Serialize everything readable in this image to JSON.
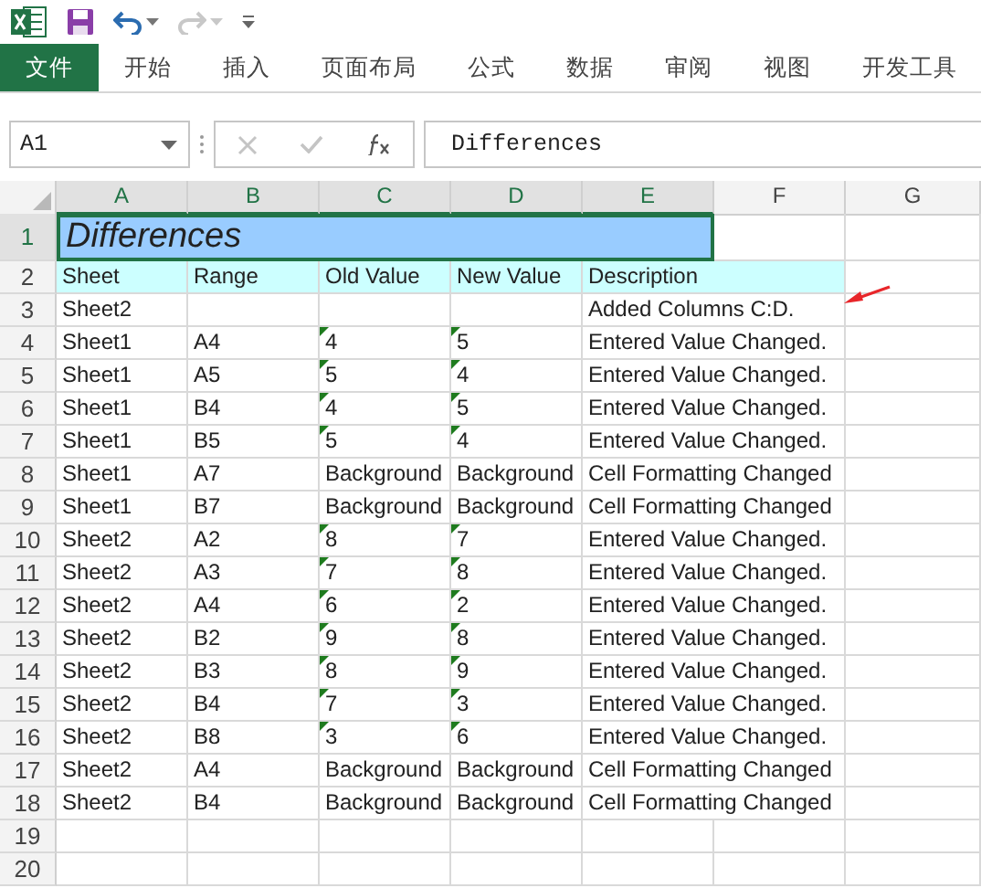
{
  "quick_access": {
    "undo_enabled": true,
    "redo_enabled": false
  },
  "ribbon_tabs": [
    {
      "label": "文件",
      "kind": "file"
    },
    {
      "label": "开始",
      "kind": "tab"
    },
    {
      "label": "插入",
      "kind": "tab"
    },
    {
      "label": "页面布局",
      "kind": "tab"
    },
    {
      "label": "公式",
      "kind": "tab"
    },
    {
      "label": "数据",
      "kind": "tab"
    },
    {
      "label": "审阅",
      "kind": "tab"
    },
    {
      "label": "视图",
      "kind": "tab"
    },
    {
      "label": "开发工具",
      "kind": "tab"
    }
  ],
  "formula_bar": {
    "name_box": "A1",
    "formula": "Differences"
  },
  "sheet": {
    "columns": [
      {
        "label": "A",
        "selected": true
      },
      {
        "label": "B",
        "selected": true
      },
      {
        "label": "C",
        "selected": true
      },
      {
        "label": "D",
        "selected": true
      },
      {
        "label": "E",
        "selected": true
      },
      {
        "label": "F",
        "selected": false
      },
      {
        "label": "G",
        "selected": false
      }
    ],
    "rows": [
      {
        "number": "1",
        "selected": true,
        "kind": "title",
        "title": "Differences"
      },
      {
        "number": "2",
        "selected": false,
        "kind": "header",
        "sheet": "Sheet",
        "range": "Range",
        "old_value": "Old Value",
        "new_value": "New Value",
        "description": "Description"
      },
      {
        "number": "3",
        "selected": false,
        "kind": "data",
        "flagged": false,
        "sheet": "Sheet2",
        "description": "Added Columns C:D."
      },
      {
        "number": "4",
        "selected": false,
        "kind": "data",
        "flagged": true,
        "sheet": "Sheet1",
        "range": "A4",
        "old_value": "4",
        "new_value": "5",
        "description": "Entered Value Changed."
      },
      {
        "number": "5",
        "selected": false,
        "kind": "data",
        "flagged": true,
        "sheet": "Sheet1",
        "range": "A5",
        "old_value": "5",
        "new_value": "4",
        "description": "Entered Value Changed."
      },
      {
        "number": "6",
        "selected": false,
        "kind": "data",
        "flagged": true,
        "sheet": "Sheet1",
        "range": "B4",
        "old_value": "4",
        "new_value": "5",
        "description": "Entered Value Changed."
      },
      {
        "number": "7",
        "selected": false,
        "kind": "data",
        "flagged": true,
        "sheet": "Sheet1",
        "range": "B5",
        "old_value": "5",
        "new_value": "4",
        "description": "Entered Value Changed."
      },
      {
        "number": "8",
        "selected": false,
        "kind": "data",
        "flagged": false,
        "sheet": "Sheet1",
        "range": "A7",
        "old_value": "Background",
        "new_value": "Background",
        "description": "Cell Formatting Changed"
      },
      {
        "number": "9",
        "selected": false,
        "kind": "data",
        "flagged": false,
        "sheet": "Sheet1",
        "range": "B7",
        "old_value": "Background",
        "new_value": "Background",
        "description": "Cell Formatting Changed"
      },
      {
        "number": "10",
        "selected": false,
        "kind": "data",
        "flagged": true,
        "sheet": "Sheet2",
        "range": "A2",
        "old_value": "8",
        "new_value": "7",
        "description": "Entered Value Changed."
      },
      {
        "number": "11",
        "selected": false,
        "kind": "data",
        "flagged": true,
        "sheet": "Sheet2",
        "range": "A3",
        "old_value": "7",
        "new_value": "8",
        "description": "Entered Value Changed."
      },
      {
        "number": "12",
        "selected": false,
        "kind": "data",
        "flagged": true,
        "sheet": "Sheet2",
        "range": "A4",
        "old_value": "6",
        "new_value": "2",
        "description": "Entered Value Changed."
      },
      {
        "number": "13",
        "selected": false,
        "kind": "data",
        "flagged": true,
        "sheet": "Sheet2",
        "range": "B2",
        "old_value": "9",
        "new_value": "8",
        "description": "Entered Value Changed."
      },
      {
        "number": "14",
        "selected": false,
        "kind": "data",
        "flagged": true,
        "sheet": "Sheet2",
        "range": "B3",
        "old_value": "8",
        "new_value": "9",
        "description": "Entered Value Changed."
      },
      {
        "number": "15",
        "selected": false,
        "kind": "data",
        "flagged": true,
        "sheet": "Sheet2",
        "range": "B4",
        "old_value": "7",
        "new_value": "3",
        "description": "Entered Value Changed."
      },
      {
        "number": "16",
        "selected": false,
        "kind": "data",
        "flagged": true,
        "sheet": "Sheet2",
        "range": "B8",
        "old_value": "3",
        "new_value": "6",
        "description": "Entered Value Changed."
      },
      {
        "number": "17",
        "selected": false,
        "kind": "data",
        "flagged": false,
        "sheet": "Sheet2",
        "range": "A4",
        "old_value": "Background",
        "new_value": "Background",
        "description": "Cell Formatting Changed"
      },
      {
        "number": "18",
        "selected": false,
        "kind": "data",
        "flagged": false,
        "sheet": "Sheet2",
        "range": "B4",
        "old_value": "Background",
        "new_value": "Background",
        "description": "Cell Formatting Changed"
      },
      {
        "number": "19",
        "selected": false,
        "kind": "empty"
      },
      {
        "number": "20",
        "selected": false,
        "kind": "empty"
      }
    ]
  }
}
